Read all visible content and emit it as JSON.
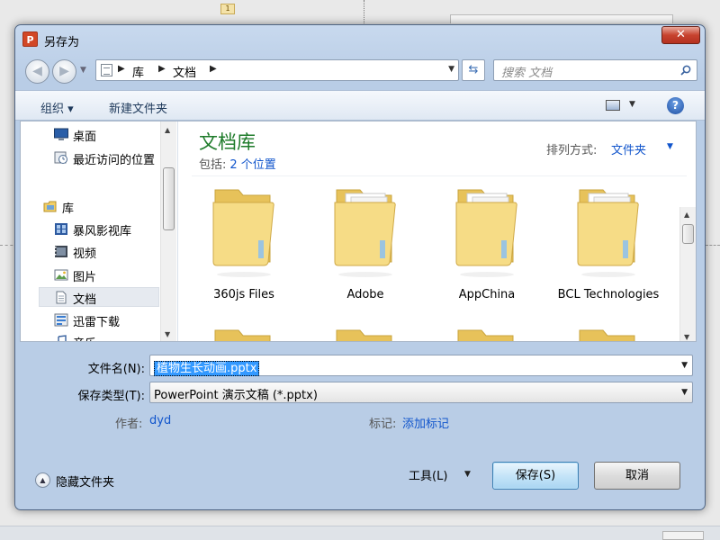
{
  "window": {
    "title": "另存为",
    "app_icon": "P",
    "close_label": "✕"
  },
  "address": {
    "crumbs": [
      "库",
      "文档"
    ],
    "search_placeholder": "搜索 文档"
  },
  "toolbar": {
    "organize": "组织 ▾",
    "new_folder": "新建文件夹",
    "help": "?"
  },
  "nav": {
    "items": [
      {
        "label": "桌面",
        "icon": "desktop-icon"
      },
      {
        "label": "最近访问的位置",
        "icon": "recent-places-icon"
      },
      {
        "label": "库",
        "icon": "libraries-icon"
      },
      {
        "label": "暴风影视库",
        "icon": "video-library-icon"
      },
      {
        "label": "视频",
        "icon": "videos-icon"
      },
      {
        "label": "图片",
        "icon": "pictures-icon"
      },
      {
        "label": "文档",
        "icon": "documents-icon",
        "selected": true
      },
      {
        "label": "迅雷下载",
        "icon": "download-icon"
      },
      {
        "label": "音乐",
        "icon": "music-icon"
      }
    ]
  },
  "library": {
    "title": "文档库",
    "includes_label": "包括:",
    "includes_link": "2 个位置",
    "sort_label": "排列方式:",
    "sort_value": "文件夹"
  },
  "files": [
    {
      "name": "360js Files"
    },
    {
      "name": "Adobe"
    },
    {
      "name": "AppChina"
    },
    {
      "name": "BCL Technologies"
    }
  ],
  "form": {
    "filename_label": "文件名(N):",
    "filename_value": "植物生长动画.pptx",
    "filetype_label": "保存类型(T):",
    "filetype_value": "PowerPoint 演示文稿 (*.pptx)",
    "author_label": "作者:",
    "author_value": "dyd",
    "tags_label": "标记:",
    "tags_value": "添加标记"
  },
  "footer": {
    "hide_folders": "隐藏文件夹",
    "tools": "工具(L)",
    "save": "保存(S)",
    "cancel": "取消"
  },
  "background": {
    "ruler_badge": "1"
  },
  "colors": {
    "library_title": "#1e7b2a",
    "link": "#1155cc",
    "folder": "#f4d67a"
  }
}
